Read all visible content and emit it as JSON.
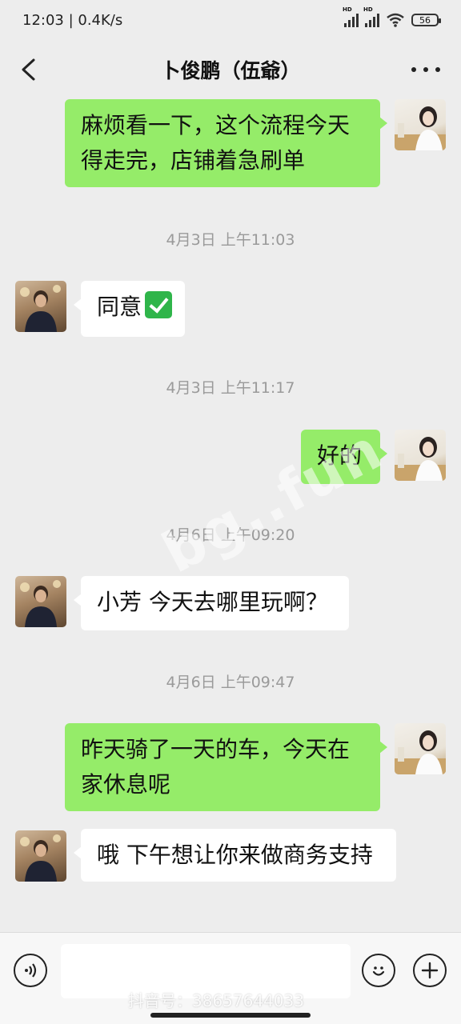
{
  "status_bar": {
    "time_speed": "12:03 | 0.4K/s",
    "signal_1_label": "HD",
    "signal_2_label": "HD",
    "battery": "56"
  },
  "nav": {
    "title": "卜俊鹏（伍爺）"
  },
  "messages": [
    {
      "type": "message",
      "sender": "me",
      "text": "麻烦看一下，这个流程今天得走完，店铺着急刷单"
    },
    {
      "type": "timestamp",
      "text": "4月3日 上午11:03"
    },
    {
      "type": "message",
      "sender": "them",
      "text": "同意"
    },
    {
      "type": "timestamp",
      "text": "4月3日 上午11:17"
    },
    {
      "type": "message",
      "sender": "me",
      "text": "好的"
    },
    {
      "type": "timestamp",
      "text": "4月6日 上午09:20"
    },
    {
      "type": "message",
      "sender": "them",
      "text": "小芳 今天去哪里玩啊？"
    },
    {
      "type": "timestamp",
      "text": "4月6日 上午09:47"
    },
    {
      "type": "message",
      "sender": "me",
      "text": "昨天骑了一天的车，今天在家休息呢"
    },
    {
      "type": "message",
      "sender": "them",
      "text": "哦 下午想让你来做商务支持"
    }
  ],
  "emoji": "check-mark-emoji",
  "watermark": "bg..fun",
  "footer_watermark": "抖音号：38657644033",
  "colors": {
    "background": "#ededed",
    "my_bubble": "#95ec69",
    "their_bubble": "#ffffff",
    "timestamp": "#9a9a9a"
  },
  "icons": {
    "back": "chevron-left-icon",
    "more": "more-dots-icon",
    "voice": "voice-icon",
    "emoji": "smiley-icon",
    "add": "plus-icon"
  }
}
